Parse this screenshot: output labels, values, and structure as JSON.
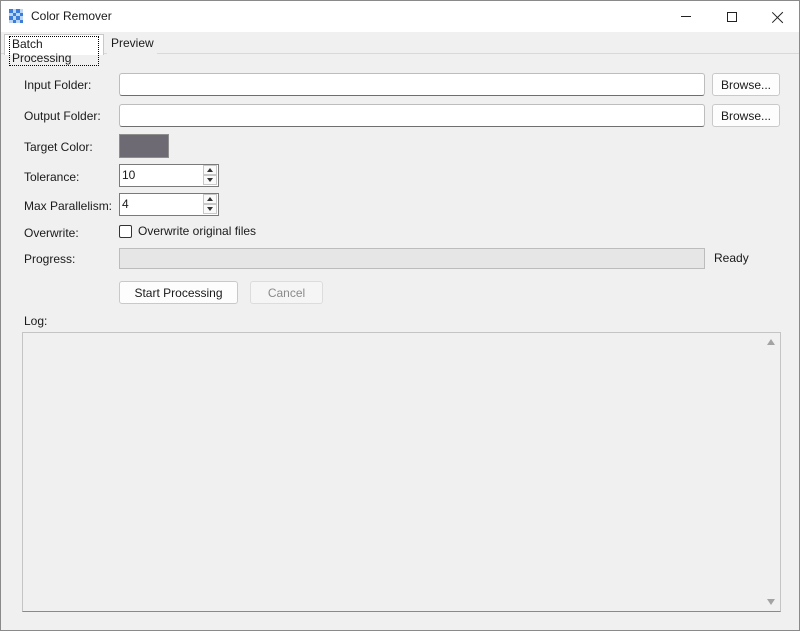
{
  "window": {
    "title": "Color Remover",
    "icon": "checkerboard-app-icon"
  },
  "tabs": [
    {
      "label": "Batch Processing",
      "active": true
    },
    {
      "label": "Preview",
      "active": false
    }
  ],
  "form": {
    "input_folder": {
      "label": "Input Folder:",
      "value": "",
      "browse_label": "Browse..."
    },
    "output_folder": {
      "label": "Output Folder:",
      "value": "",
      "browse_label": "Browse..."
    },
    "target_color": {
      "label": "Target Color:",
      "color": "#6e6a73"
    },
    "tolerance": {
      "label": "Tolerance:",
      "value": "10"
    },
    "max_parallelism": {
      "label": "Max Parallelism:",
      "value": "4"
    },
    "overwrite": {
      "label": "Overwrite:",
      "checkbox_label": "Overwrite original files",
      "checked": false
    },
    "progress": {
      "label": "Progress:",
      "fraction": 0,
      "status": "Ready"
    }
  },
  "actions": {
    "start_label": "Start Processing",
    "cancel_label": "Cancel",
    "cancel_enabled": false
  },
  "log": {
    "label": "Log:",
    "content": ""
  }
}
